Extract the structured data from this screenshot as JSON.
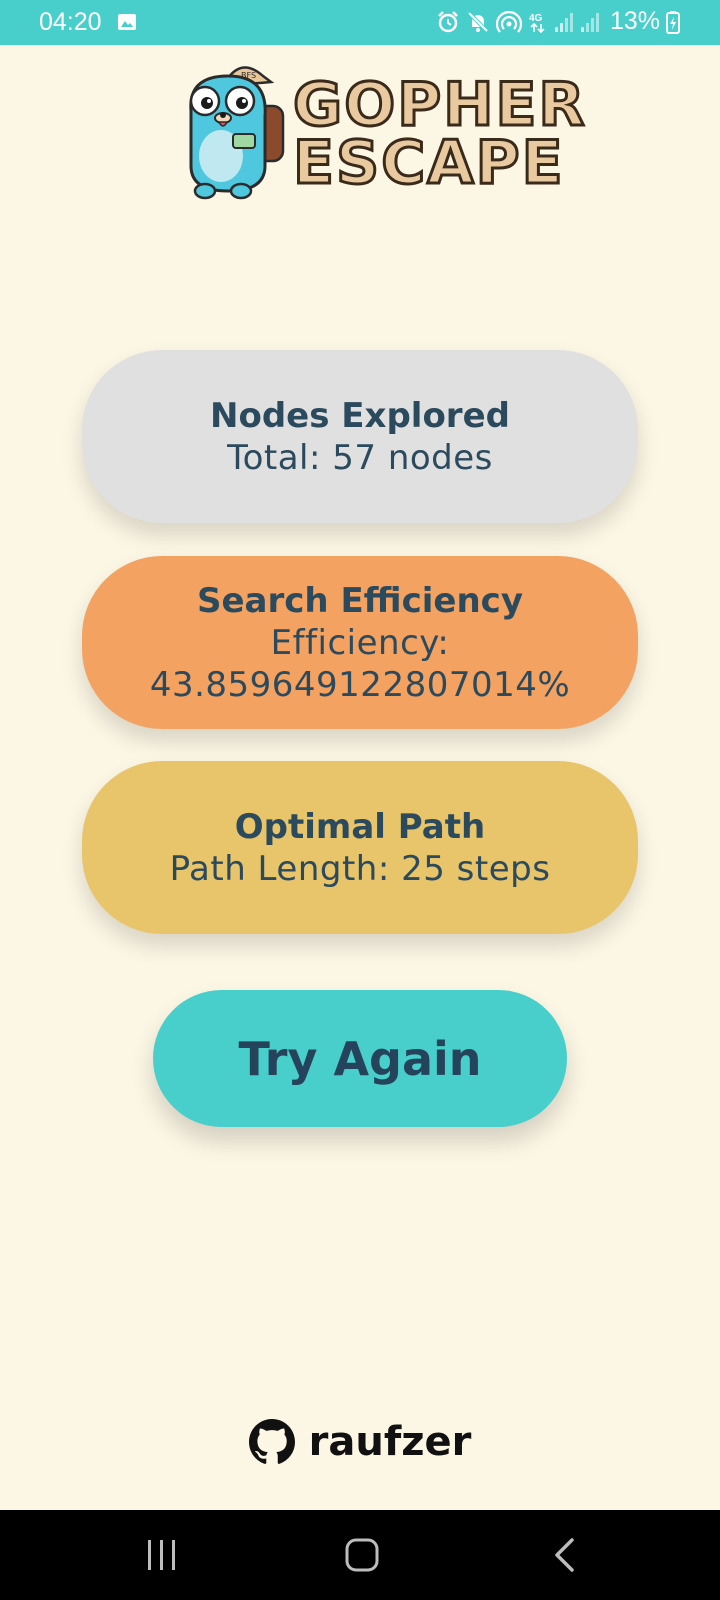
{
  "status_bar": {
    "time": "04:20",
    "battery": "13%",
    "icons": [
      "gallery-icon",
      "alarm-icon",
      "mute-icon",
      "hotspot-icon",
      "4g-icon",
      "signal-icon",
      "signal-icon",
      "battery-charging-icon"
    ]
  },
  "logo": {
    "line1": "GOPHER",
    "line2": "ESCAPE",
    "mascot": "gopher-mascot"
  },
  "cards": {
    "nodes": {
      "title": "Nodes Explored",
      "value": "Total: 57 nodes"
    },
    "efficiency": {
      "title": "Search Efficiency",
      "value": "Efficiency: 43.859649122807014%"
    },
    "path": {
      "title": "Optimal Path",
      "value": "Path Length: 25 steps"
    }
  },
  "actions": {
    "try_again": "Try Again"
  },
  "footer": {
    "username": "raufzer",
    "icon": "github-icon"
  },
  "nav": {
    "buttons": [
      "recent-apps",
      "home",
      "back"
    ]
  },
  "colors": {
    "background": "#fcf6e5",
    "accent": "#48cfcb",
    "text": "#2b4a5d",
    "nodes_card": "#e0e0e0",
    "efficiency_card": "#f3a261",
    "path_card": "#e8c46a"
  }
}
